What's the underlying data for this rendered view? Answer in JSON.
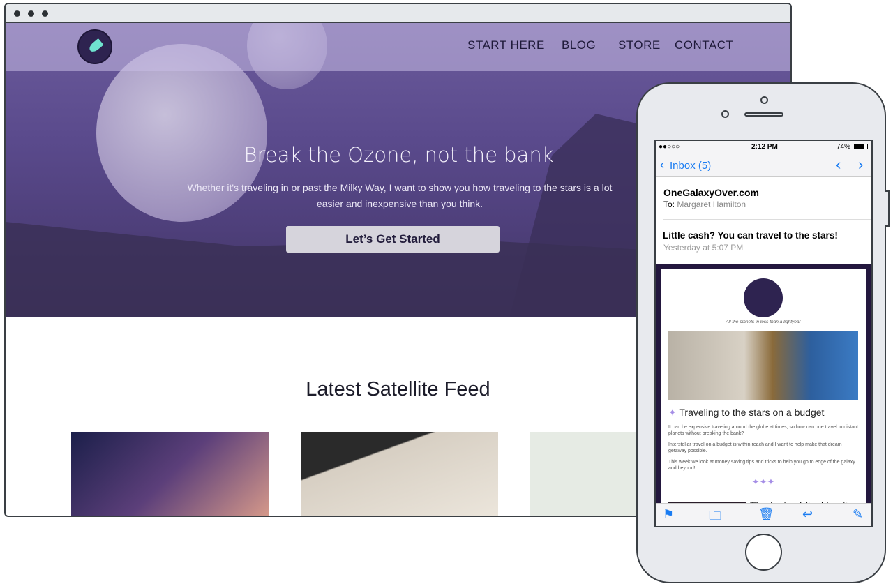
{
  "browser": {
    "nav": [
      "START HERE",
      "BLOG",
      "STORE",
      "CONTACT"
    ],
    "hero": {
      "title": "Break the Ozone, not the bank",
      "subtitle": "Whether it's traveling in or past the Milky Way, I want to show you how traveling to the stars is a lot easier and inexpensive than you think.",
      "cta": "Let’s Get Started"
    },
    "feed_title": "Latest Satellite Feed"
  },
  "phone": {
    "status": {
      "signal": "●●○○○",
      "time": "2:12 PM",
      "battery": "74%"
    },
    "back_label": "Inbox (5)",
    "from": "OneGalaxyOver.com",
    "to_label": "To:",
    "to": "Margaret Hamilton",
    "subject": "Little cash? You can travel to the stars!",
    "date": "Yesterday at 5:07 PM",
    "email": {
      "tagline": "All the planets in less than a lightyear",
      "heading": "Traveling to the stars on a budget",
      "paragraphs": [
        "It can be expensive traveling around the globe at times, so how can one travel to distant planets without breaking the bank?",
        "Interstellar travel on a budget is within reach and I want to help make that dream getaway possible.",
        "This week we look at money saving tips and tricks to help you go to edge of the galaxy and beyond!"
      ],
      "next_heading": "The (not so) final frontier"
    }
  },
  "colors": {
    "accent": "#1a7cf2",
    "brand_purple": "#23173e",
    "rocket": "#6fe3cf"
  }
}
